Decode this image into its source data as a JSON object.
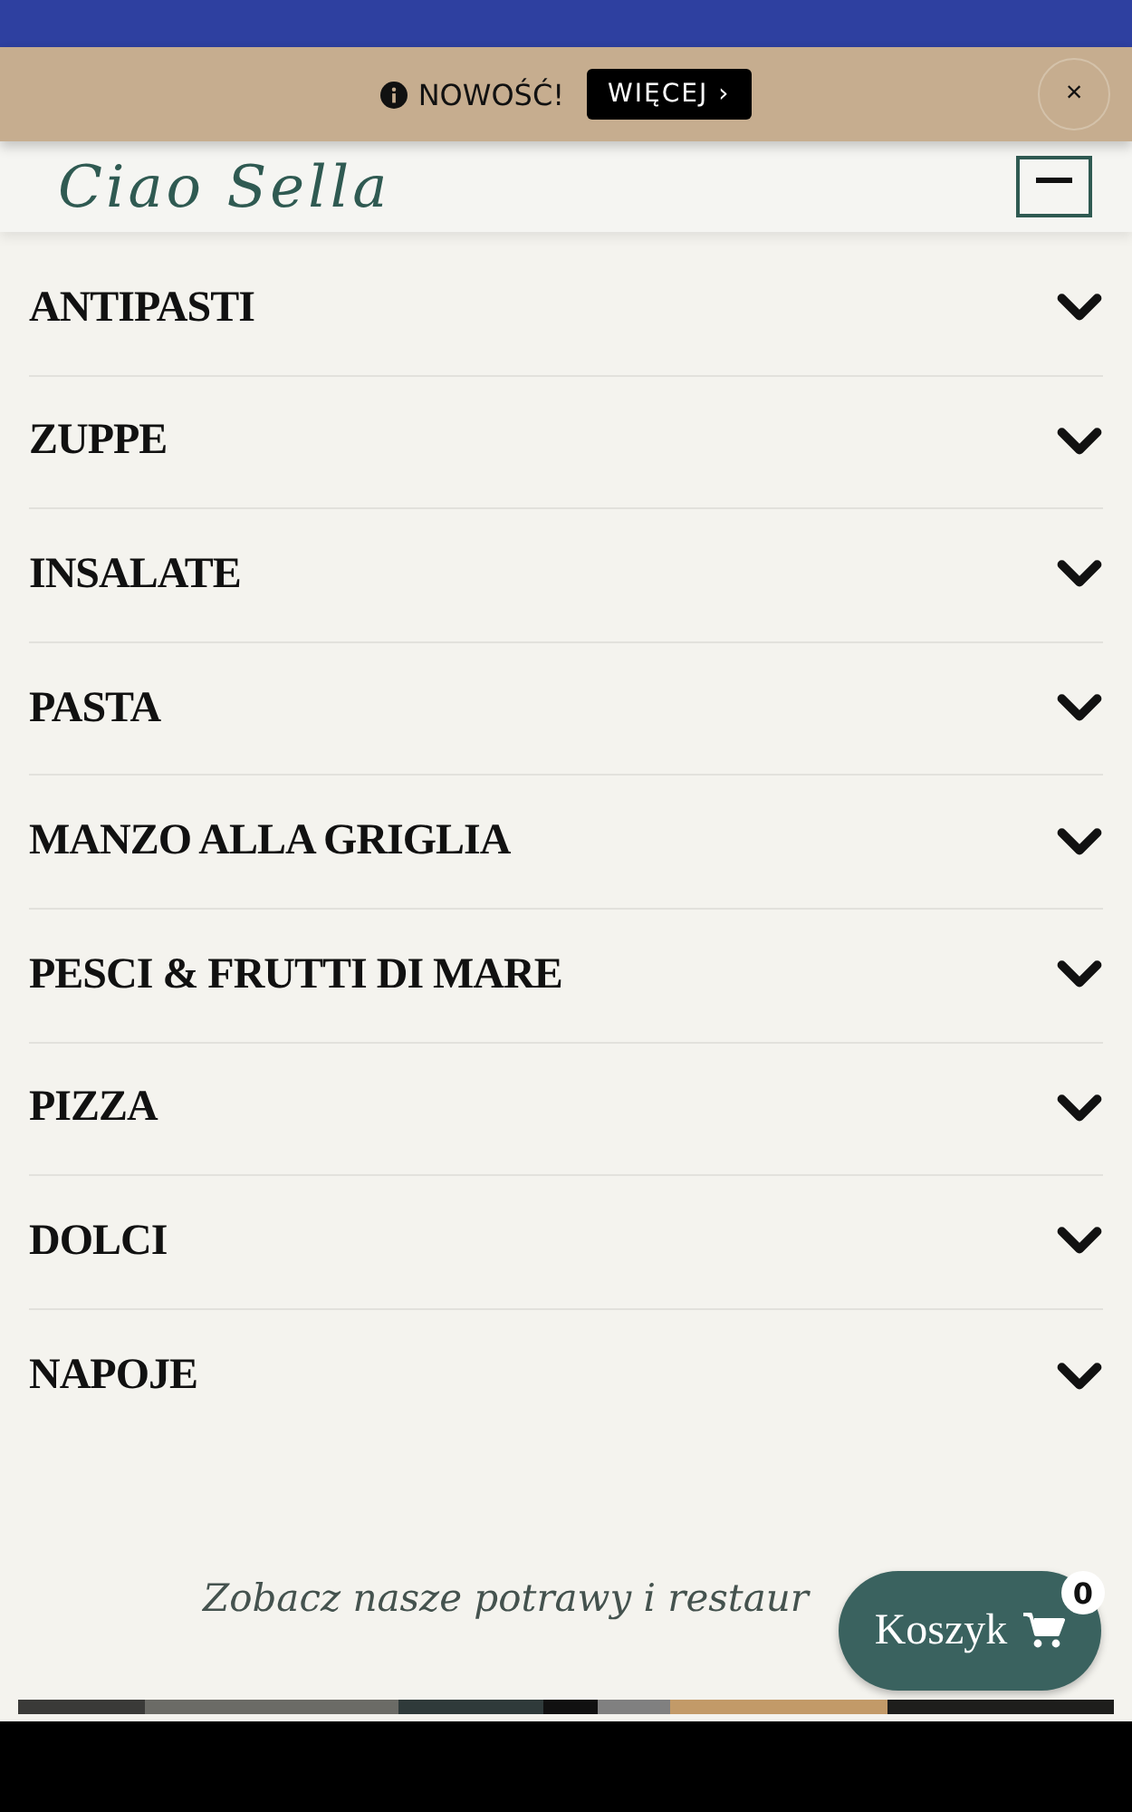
{
  "announcement": {
    "text": "NOWOŚĆ!",
    "button": "WIĘCEJ ›",
    "close": "×"
  },
  "header": {
    "logo": "Ciao Sella"
  },
  "menu": [
    {
      "label": "ANTIPASTI",
      "expanded": false
    },
    {
      "label": "ZUPPE",
      "expanded": false
    },
    {
      "label": "INSALATE",
      "expanded": false
    },
    {
      "label": "PASTA",
      "expanded": false
    },
    {
      "label": "MANZO ALLA GRIGLIA",
      "expanded": false
    },
    {
      "label": "PESCI & FRUTTI DI MARE",
      "expanded": false
    },
    {
      "label": "PIZZA",
      "expanded": false
    },
    {
      "label": "DOLCI",
      "expanded": false
    },
    {
      "label": "NAPOJE",
      "expanded": false
    }
  ],
  "section": {
    "heading": "Zobacz nasze potrawy i restaur"
  },
  "cart": {
    "label": "Koszyk",
    "count": "0"
  }
}
